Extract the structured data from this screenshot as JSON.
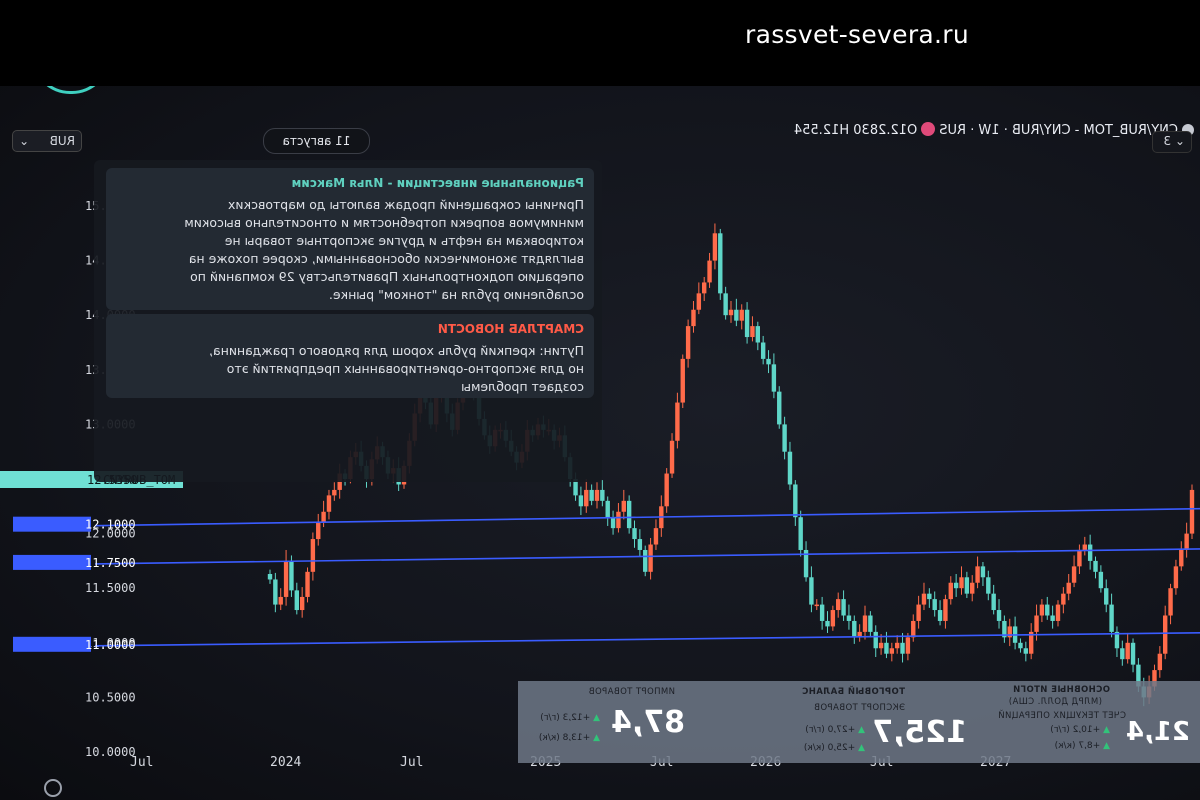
{
  "site": {
    "url": "rassvet-severa.ru"
  },
  "toolbar": {
    "symbol": "CNY/RUB_TOM - CNY/RUB · 1W · RUS",
    "ohlc": "O12.2830 H12.554",
    "currency": "RUB",
    "period": "3"
  },
  "news": {
    "date": "11 августа",
    "items": [
      {
        "source": "Рациональные инвестиции - Илья Максим",
        "color": "teal",
        "body": [
          "Причины сокращений продаж валюты до мартовских",
          "минимумов вопреки потребностям и относительно высоким",
          "котировкам на нефть и другие экспортные товары не",
          "выглядят экономически обоснованными, скорее похоже на",
          "операцию подконтрольных Правительству 29 компаний по",
          "ослаблению рубля на \"тонком\" рынке."
        ]
      },
      {
        "source": "СМАРТЛАБ НОВОСТИ",
        "color": "red",
        "body": [
          "Путин: крепкий рубль хорош для рядового гражданина,",
          "но для экспортно-ориентированных предприятий это",
          "создает проблемы"
        ]
      }
    ]
  },
  "stats": {
    "blocks": [
      {
        "title": "ОСНОВНЫЕ ИТОГИ",
        "subtitle": "(МЛРД ДОЛЛ. США)",
        "label": "СЧЕТ ТЕКУЩИХ ОПЕРАЦИЙ",
        "value": "21,4",
        "changes": [
          "+10,2 (г/г)",
          "+8,7 (к/к)"
        ]
      },
      {
        "title": "ТОРГОВЫЙ БАЛАНС",
        "label": "ЭКСПОРТ ТОВАРОВ",
        "value": "125,7",
        "changes": [
          "+27,0 (г/г)",
          "+25,0 (к/к)"
        ]
      },
      {
        "label": "ИМПОРТ ТОВАРОВ",
        "value": "87,4",
        "changes": [
          "+12,3 (г/г)",
          "+13,8 (к/к)"
        ]
      }
    ]
  },
  "chart_data": {
    "type": "candlestick",
    "title": "CNY/RUB_TOM - CNY/RUB · 1W · RUS",
    "ylim": [
      10.0,
      15.0
    ],
    "y_ticks": [
      "15.0000",
      "14.5000",
      "14.0000",
      "13.5000",
      "13.0000",
      "12.5000",
      "12.0000",
      "11.5000",
      "11.0000",
      "10.5000",
      "10.0000"
    ],
    "x_ticks": [
      "Jul",
      "2024",
      "Jul",
      "2025",
      "Jul",
      "2026",
      "Jul",
      "2027"
    ],
    "horizontal_lines": [
      {
        "label": "12.1000",
        "value": 12.1
      },
      {
        "label": "11.7500",
        "value": 11.75
      },
      {
        "label": "11.0000",
        "value": 11.0
      }
    ],
    "price_tag": {
      "name": "CNYRUB_TOM",
      "value": "12.5350"
    },
    "colors": {
      "up": "#ff6b4a",
      "down": "#5fd6c8",
      "level": "#3a5cff",
      "tag": "#6fe0d4"
    },
    "closes": [
      11.58,
      11.35,
      11.42,
      11.75,
      11.48,
      11.3,
      11.42,
      11.65,
      11.95,
      12.1,
      12.2,
      12.35,
      12.4,
      12.55,
      12.5,
      12.7,
      12.75,
      12.62,
      12.5,
      12.68,
      12.8,
      12.7,
      12.55,
      12.6,
      12.45,
      12.62,
      12.85,
      13.1,
      13.3,
      13.2,
      13.0,
      13.25,
      13.45,
      13.1,
      12.95,
      13.2,
      13.6,
      13.5,
      13.3,
      13.05,
      12.9,
      12.8,
      12.95,
      12.95,
      12.85,
      12.75,
      12.65,
      12.75,
      12.95,
      12.9,
      13.0,
      12.95,
      12.95,
      12.85,
      12.9,
      12.7,
      12.5,
      12.35,
      12.25,
      12.4,
      12.3,
      12.4,
      12.3,
      12.15,
      12.05,
      12.2,
      12.3,
      12.05,
      11.95,
      11.85,
      11.65,
      11.9,
      12.05,
      12.25,
      12.55,
      12.85,
      13.2,
      13.6,
      13.9,
      14.05,
      14.2,
      14.3,
      14.5,
      14.75,
      14.2,
      14.0,
      14.05,
      13.95,
      14.05,
      13.8,
      13.9,
      13.75,
      13.6,
      13.55,
      13.3,
      13.0,
      12.75,
      12.45,
      12.15,
      11.85,
      11.6,
      11.35,
      11.35,
      11.2,
      11.15,
      11.3,
      11.4,
      11.25,
      11.2,
      11.05,
      11.1,
      11.25,
      11.1,
      10.95,
      11.0,
      10.9,
      10.95,
      11.0,
      10.9,
      11.05,
      11.2,
      11.35,
      11.45,
      11.4,
      11.3,
      11.2,
      11.4,
      11.55,
      11.5,
      11.6,
      11.45,
      11.55,
      11.7,
      11.6,
      11.45,
      11.3,
      11.2,
      11.05,
      11.15,
      11.0,
      10.95,
      10.9,
      11.1,
      11.25,
      11.35,
      11.25,
      11.2,
      11.35,
      11.45,
      11.55,
      11.7,
      11.85,
      11.9,
      11.75,
      11.65,
      11.5,
      11.35,
      11.1,
      10.95,
      10.85,
      11.0,
      10.8,
      10.6,
      10.5,
      10.6,
      10.75,
      10.9,
      11.25,
      11.5,
      11.7,
      11.85,
      12.0,
      12.4
    ]
  }
}
